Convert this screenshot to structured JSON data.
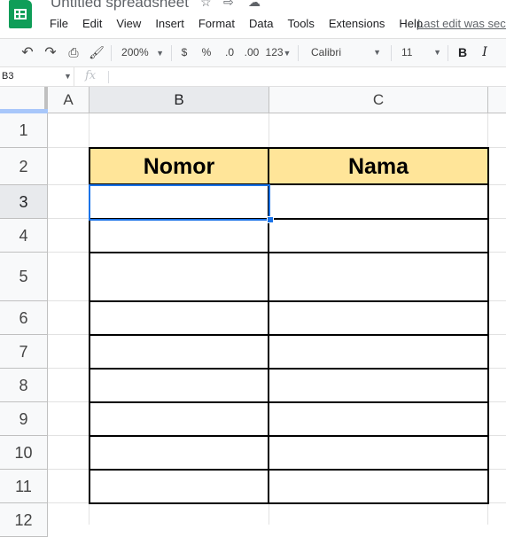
{
  "app": {
    "doc_title": "Untitled spreadsheet",
    "menu": [
      "File",
      "Edit",
      "View",
      "Insert",
      "Format",
      "Data",
      "Tools",
      "Extensions",
      "Help"
    ],
    "last_edit": "Last edit was seco"
  },
  "toolbar": {
    "zoom": "200%",
    "currency": "$",
    "percent": "%",
    "decrease_decimal": ".0",
    "increase_decimal": ".00",
    "more_formats": "123",
    "font": "Calibri",
    "font_size": "11",
    "bold": "B",
    "italic": "I"
  },
  "formula_bar": {
    "name_box": "B3",
    "fx_label": "fx",
    "value": ""
  },
  "grid": {
    "columns": [
      "A",
      "B",
      "C"
    ],
    "selected_column": "B",
    "rows": [
      "1",
      "2",
      "3",
      "4",
      "5",
      "6",
      "7",
      "8",
      "9",
      "10",
      "11",
      "12"
    ],
    "selected_row": "3",
    "active_cell": "B3"
  },
  "table": {
    "header_fill": "#ffe599",
    "headers": [
      "Nomor",
      "Nama"
    ]
  },
  "colors": {
    "selection": "#1a73e8",
    "sheets_green": "#0f9d58"
  }
}
